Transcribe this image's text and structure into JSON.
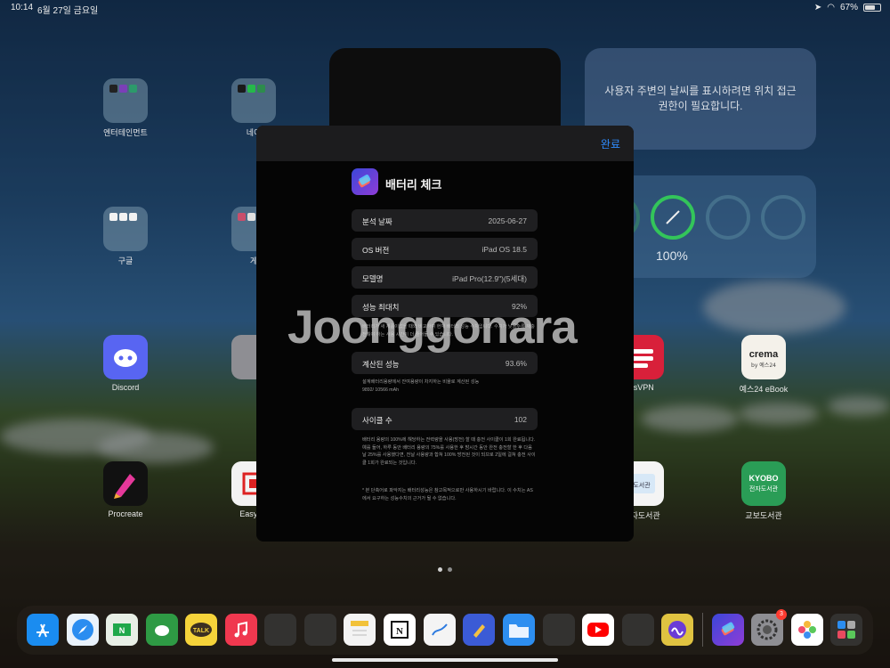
{
  "status": {
    "time": "10:14",
    "date": "6월 27일 금요일",
    "battery": "67%"
  },
  "widgets": {
    "weather_text": "사용자 주변의 날씨를 표시하려면 위치 접근 권한이 필요합니다.",
    "battery_percent": "100%"
  },
  "apps": [
    {
      "label": "엔터테인먼트"
    },
    {
      "label": "네이"
    },
    {
      "label": "구글"
    },
    {
      "label": "게"
    },
    {
      "label": "Discord"
    },
    {
      "label": "ssVPN"
    },
    {
      "label": "예스24 eBook"
    },
    {
      "label": "Procreate"
    },
    {
      "label": "EasyCa"
    },
    {
      "label": "전자도서관"
    },
    {
      "label": "교보도서관"
    }
  ],
  "modal": {
    "done": "완료",
    "title": "배터리 체크",
    "rows": [
      {
        "key": "분석 날짜",
        "value": "2025-06-27"
      },
      {
        "key": "OS 버전",
        "value": "iPad OS 18.5"
      },
      {
        "key": "모델명",
        "value": "iPad Pro(12.9\")(5세대)"
      },
      {
        "key": "성능 최대치",
        "value": "92%"
      },
      {
        "key": "계산된 성능",
        "value": "93.6%"
      },
      {
        "key": "사이클 수",
        "value": "102"
      }
    ],
    "note1": "배터리가 새 제품이었을 때와 비교하여 현재 배터리 성능 수치입니다. 수치가 낮을수록 재충전해야 하는 사용 시간이 더 줄어들 수 있습니다.",
    "note2a": "설계배터리용량에서 잔여용량이 차지하는 비율로 계산된 성능",
    "note2b": "9892/ 10566 mAh",
    "note3": "배터리 용량의 100%에 해당하는 전력량을 사용(방전) 할 때 충전 사이클이 1회 완료됩니다. 예를 들어, 하루 동안 배터리 용량의 75%를 사용한 후 밤시간 동안 완전 충전할 한 후 다음 날 25%를 사용했다면, 전날 사용량과 합쳐 100% 방전된 것이 되므로 2일에 걸쳐 충전 사이클 1회가 완료되는 것입니다.",
    "note4": "* 본 단축어로 파악지는 배터리성능은 참고목적으로만 사용하시기 바랍니다. 이 수치는 AS에서 요구하는 성능수치의 근거가 될 수 없습니다."
  },
  "watermark": "Joonggonara",
  "dock": [
    "App Store",
    "Safari",
    "네이버 메일",
    "Evernote",
    "KakaoTalk",
    "Music",
    "폴더",
    "폴더",
    "메모",
    "Notion",
    "Freeform",
    "Goodnotes",
    "Files",
    "폴더",
    "YouTube",
    "폴더",
    "Yesterday",
    "Shortcuts",
    "Settings",
    "Photos",
    "App Library"
  ],
  "settings_badge": "3"
}
